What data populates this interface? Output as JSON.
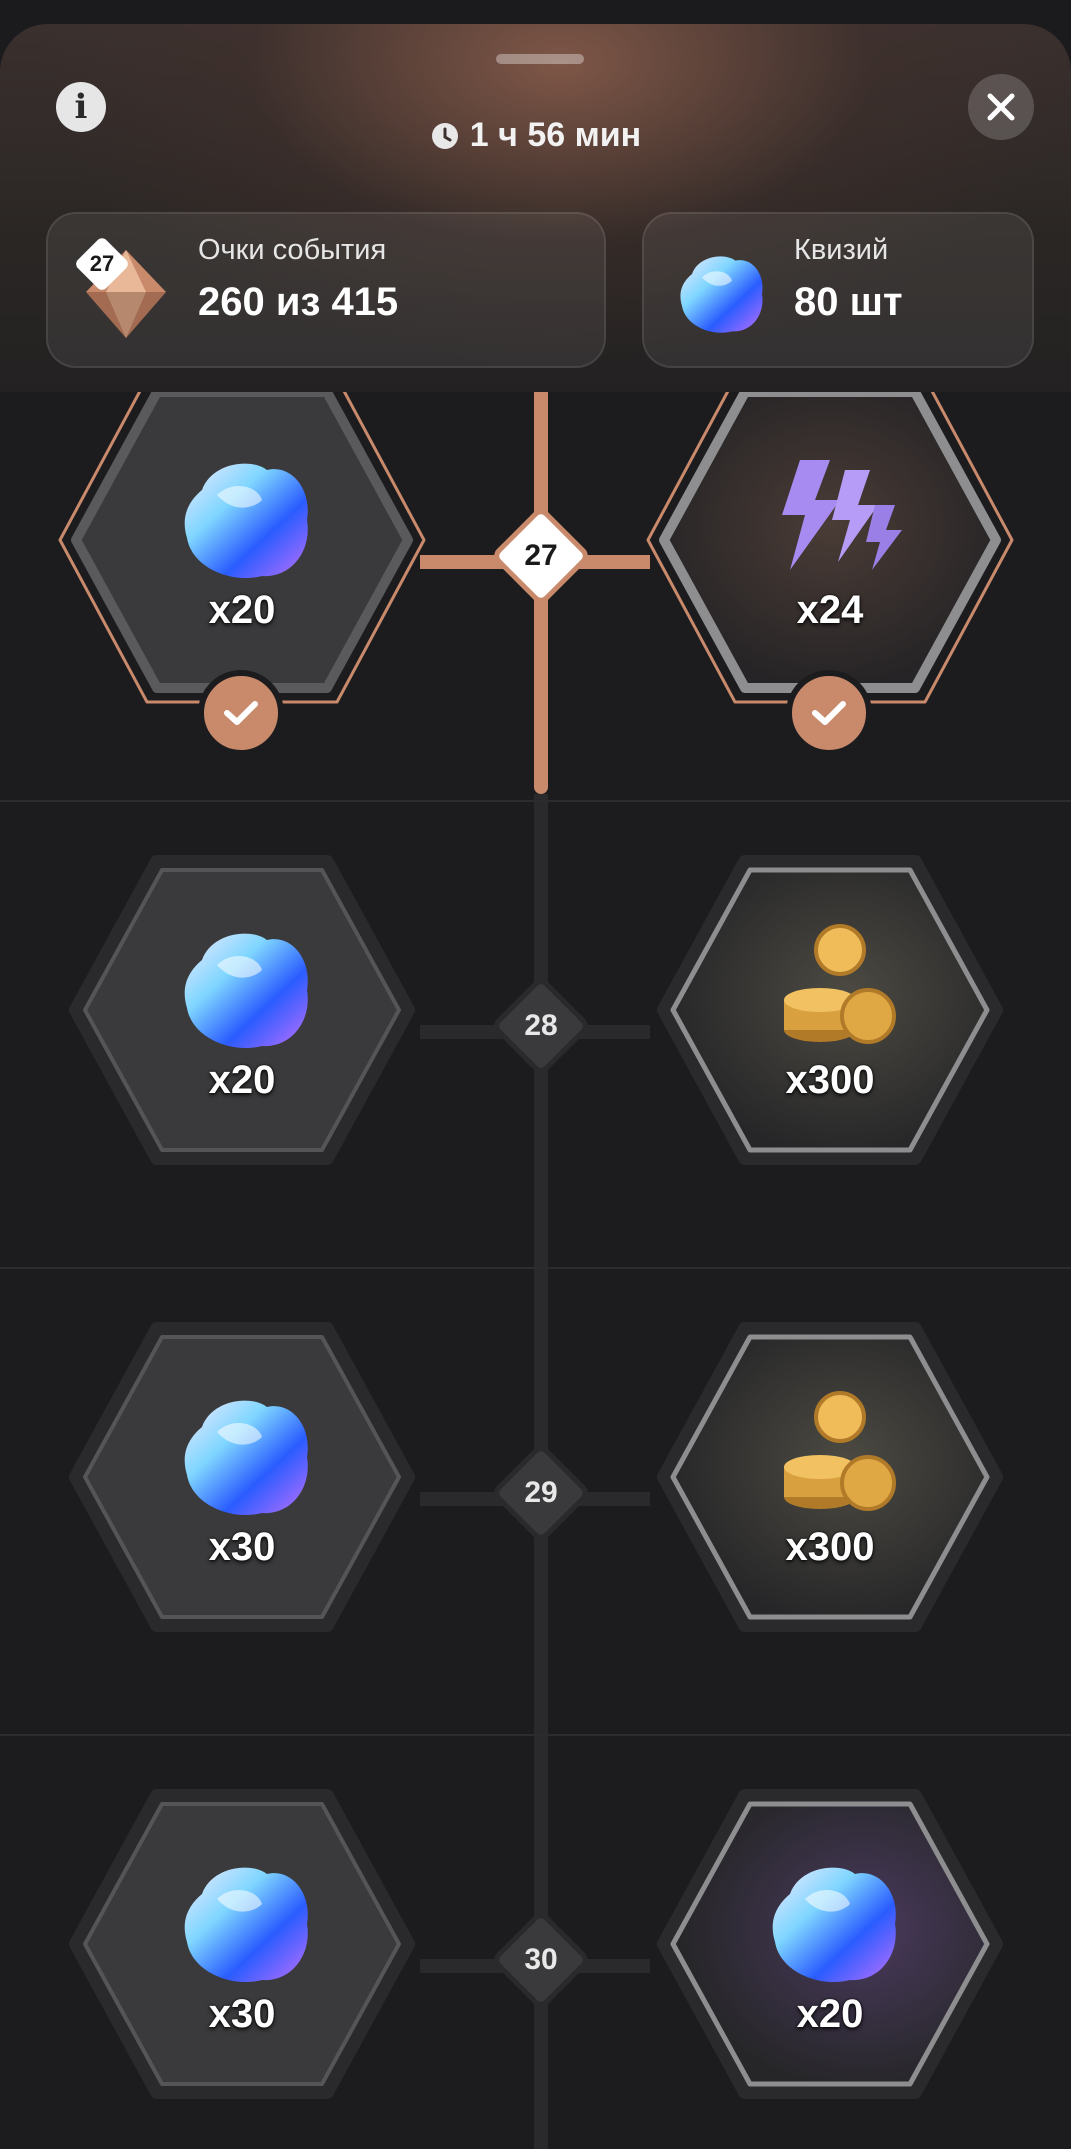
{
  "header": {
    "timer": "1 ч 56 мин",
    "event_points": {
      "label": "Очки события",
      "value": "260 из 415",
      "level_badge": "27"
    },
    "currency": {
      "label": "Квизий",
      "value": "80 шт"
    }
  },
  "levels": [
    {
      "number": "27",
      "state": "claimed",
      "left": {
        "icon": "crystal-icon",
        "qty": "x20",
        "claimed": true
      },
      "right": {
        "icon": "lightning-icon",
        "qty": "x24",
        "claimed": true
      }
    },
    {
      "number": "28",
      "state": "locked",
      "left": {
        "icon": "crystal-icon",
        "qty": "x20",
        "claimed": false
      },
      "right": {
        "icon": "coins-icon",
        "qty": "x300",
        "claimed": false
      }
    },
    {
      "number": "29",
      "state": "locked",
      "left": {
        "icon": "crystal-icon",
        "qty": "x30",
        "claimed": false
      },
      "right": {
        "icon": "coins-icon",
        "qty": "x300",
        "claimed": false
      }
    },
    {
      "number": "30",
      "state": "locked",
      "left": {
        "icon": "crystal-icon",
        "qty": "x30",
        "claimed": false
      },
      "right": {
        "icon": "crystal-icon",
        "qty": "x20",
        "claimed": false
      }
    }
  ],
  "colors": {
    "accent": "#c98a6c",
    "background": "#1c1c1e",
    "track": "#2a2a2c"
  }
}
